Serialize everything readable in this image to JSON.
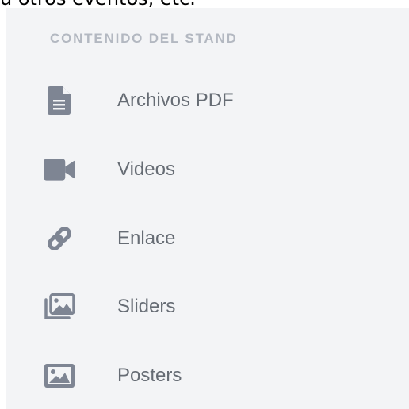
{
  "top_text": "u otros eventos, etc.",
  "sidebar": {
    "heading": "CONTENIDO DEL STAND",
    "items": [
      {
        "label": "Archivos PDF",
        "icon": "file-pdf-icon"
      },
      {
        "label": "Videos",
        "icon": "video-camera-icon"
      },
      {
        "label": "Enlace",
        "icon": "link-icon"
      },
      {
        "label": "Sliders",
        "icon": "images-icon"
      },
      {
        "label": "Posters",
        "icon": "image-icon"
      }
    ]
  },
  "colors": {
    "panel_bg": "#f3f4f6",
    "heading": "#b3b8c1",
    "label": "#666c74",
    "icon": "#7e8593"
  }
}
